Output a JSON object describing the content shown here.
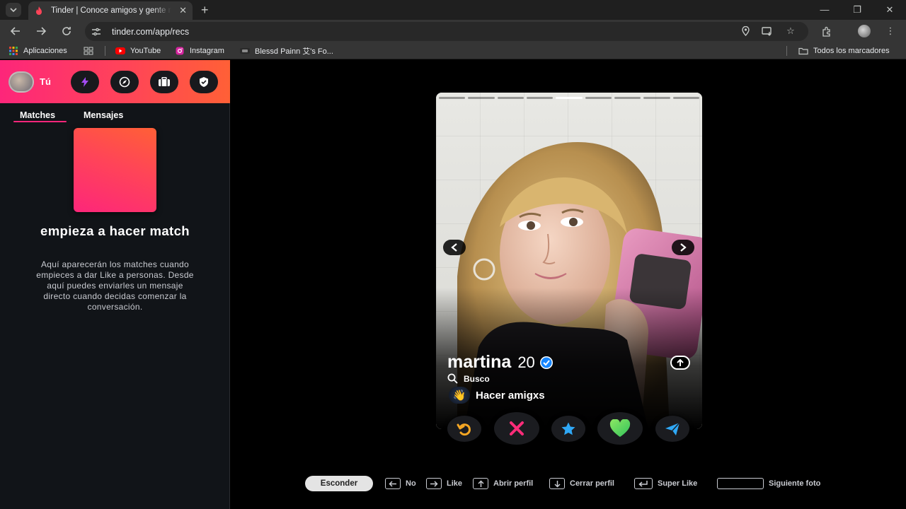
{
  "browser": {
    "tab_title": "Tinder | Conoce amigos y gente nueva",
    "url": "tinder.com/app/recs",
    "bookmarks": [
      "Aplicaciones",
      "YouTube",
      "Instagram",
      "Blessd Painn 艾's Fo..."
    ],
    "all_bookmarks": "Todos los marcadores"
  },
  "sidebar": {
    "me_label": "Tú",
    "tabs": [
      "Matches",
      "Mensajes"
    ],
    "active_tab": "Matches",
    "empty_title": "empieza a hacer match",
    "empty_desc": "Aquí aparecerán los matches cuando empieces a dar Like a personas. Desde aquí puedes enviarles un mensaje directo cuando decidas comenzar la conversación.",
    "header_icons": [
      "boost-icon",
      "explore-icon",
      "briefcase-icon",
      "shield-icon"
    ]
  },
  "profile": {
    "name": "martina",
    "age": "20",
    "verified": true,
    "looking_label": "Busco",
    "goal_emoji": "👋",
    "goal": "Hacer amigxs",
    "photo_count": 9,
    "active_photo": 5
  },
  "actions": [
    "rewind-icon",
    "nope-icon",
    "super-like-icon",
    "like-icon",
    "boost-send-icon"
  ],
  "hints": {
    "hide": "Esconder",
    "no": "No",
    "like": "Like",
    "open_profile": "Abrir perfil",
    "close_profile": "Cerrar perfil",
    "super_like": "Super Like",
    "next_photo": "Siguiente foto"
  },
  "colors": {
    "brand_start": "#fd267a",
    "brand_end": "#ff6036",
    "nope": "#ff4458",
    "like": "#5cdf6e",
    "super_like": "#2fa8f6",
    "rewind": "#f5a623",
    "boost": "#a54bf5"
  }
}
